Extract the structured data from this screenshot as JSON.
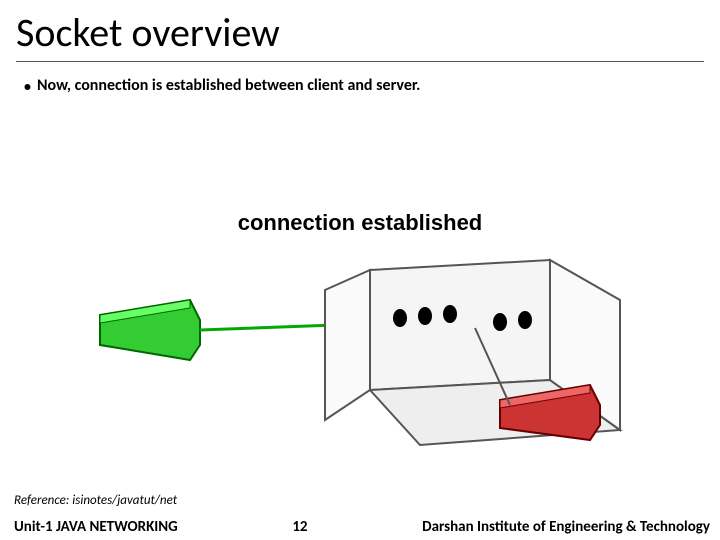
{
  "title": "Socket overview",
  "bullet": "Now, connection is established between client and server.",
  "diagram_label": "connection established",
  "reference": "Reference: isinotes/javatut/net",
  "footer": {
    "left": "Unit-1 JAVA NETWORKING",
    "center": "12",
    "right": "Darshan Institute of Engineering & Technology"
  }
}
